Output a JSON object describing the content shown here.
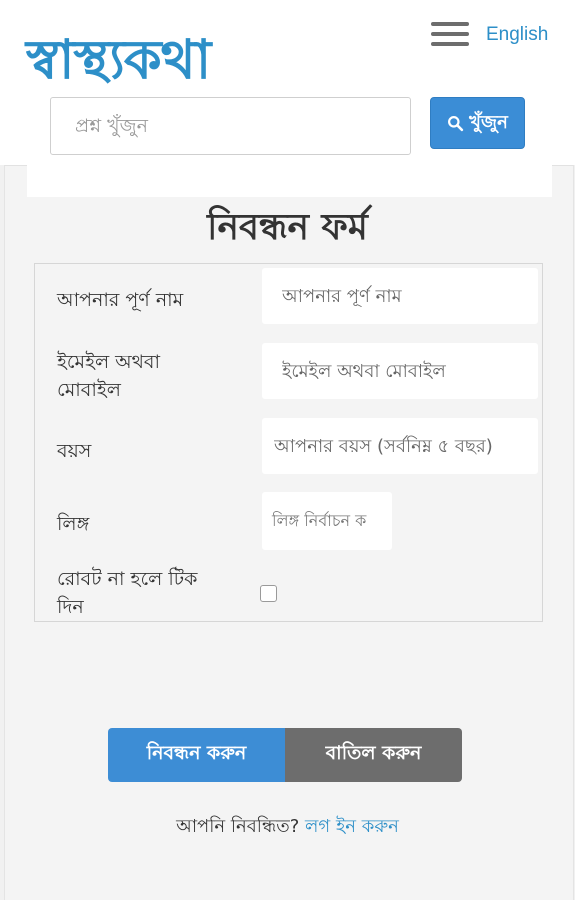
{
  "header": {
    "logo_text": "স্বাস্থ্যকথা",
    "language_link": "English",
    "menu_icon": "hamburger-menu-icon",
    "search": {
      "placeholder": "প্রশ্ন খুঁজুন",
      "button_label": "খুঁজুন",
      "button_icon": "search-icon"
    }
  },
  "form": {
    "title": "নিবন্ধন ফর্ম",
    "fields": {
      "name": {
        "label": "আপনার পূর্ণ নাম",
        "placeholder": "আপনার পূর্ণ নাম"
      },
      "contact": {
        "label_line1": "ইমেইল অথবা",
        "label_line2": "মোবাইল",
        "placeholder": "ইমেইল অথবা মোবাইল"
      },
      "age": {
        "label": "বয়স",
        "placeholder": "আপনার বয়স (সর্বনিম্ন ৫ বছর)"
      },
      "gender": {
        "label": "লিঙ্গ",
        "selected": "লিঙ্গ নির্বাচন ক"
      },
      "robot": {
        "label_line1": "রোবট না হলে টিক",
        "label_line2": "দিন",
        "checked": false
      }
    },
    "buttons": {
      "register": "নিবন্ধন করুন",
      "cancel": "বাতিল করুন"
    },
    "login_prompt": "আপনি নিবন্ধিত?",
    "login_link": "লগ ইন করুন"
  },
  "colors": {
    "brand": "#2d8fc8",
    "primary_button": "#3d8dd5",
    "secondary_button": "#6d6d6d"
  }
}
